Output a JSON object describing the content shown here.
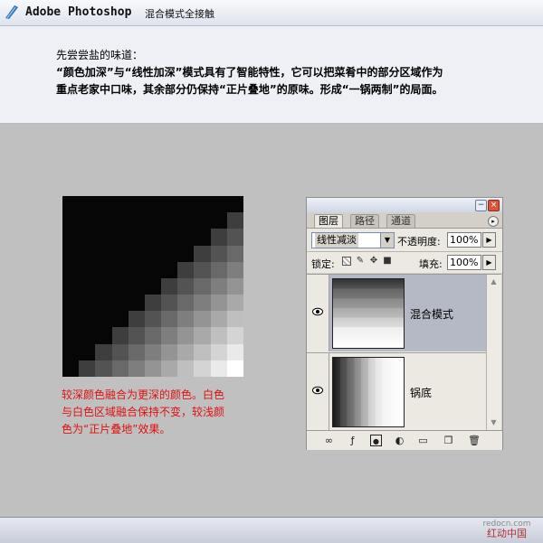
{
  "header": {
    "app_title": "Adobe Photoshop",
    "subtitle": "混合模式全接触",
    "intro_lines": [
      "先尝尝盐的味道：",
      "“颜色加深”与“线性加深”模式具有了智能特性，它可以把菜肴中的部分区域作为",
      "重点老家中口味，其余部分仍保持“正片叠地”的原味。形成“一锅两制”的局面。"
    ]
  },
  "caption": {
    "lines": [
      "较深颜色融合为更深的颜色。白色",
      "与白色区域融合保持不变，较浅颜",
      "色为“正片叠地”效果。"
    ]
  },
  "panel": {
    "tabs": [
      "图层",
      "路径",
      "通道"
    ],
    "blend_mode": "线性减淡",
    "opacity_label": "不透明度:",
    "opacity_value": "100%",
    "lock_label": "锁定:",
    "fill_label": "填充:",
    "fill_value": "100%",
    "layers": [
      {
        "name": "混合模式",
        "selected": true
      },
      {
        "name": "锅底",
        "selected": false
      }
    ],
    "icons": [
      "link-icon",
      "style-icon",
      "mask-icon",
      "adjustment-icon",
      "group-icon",
      "new-layer-icon",
      "trash-icon"
    ]
  },
  "watermark": {
    "url": "redocn.com",
    "name": "红动中国"
  },
  "colors": {
    "caption": "#e01010",
    "background": "#c0c0c0",
    "selected_layer": "#b5b9c6"
  }
}
